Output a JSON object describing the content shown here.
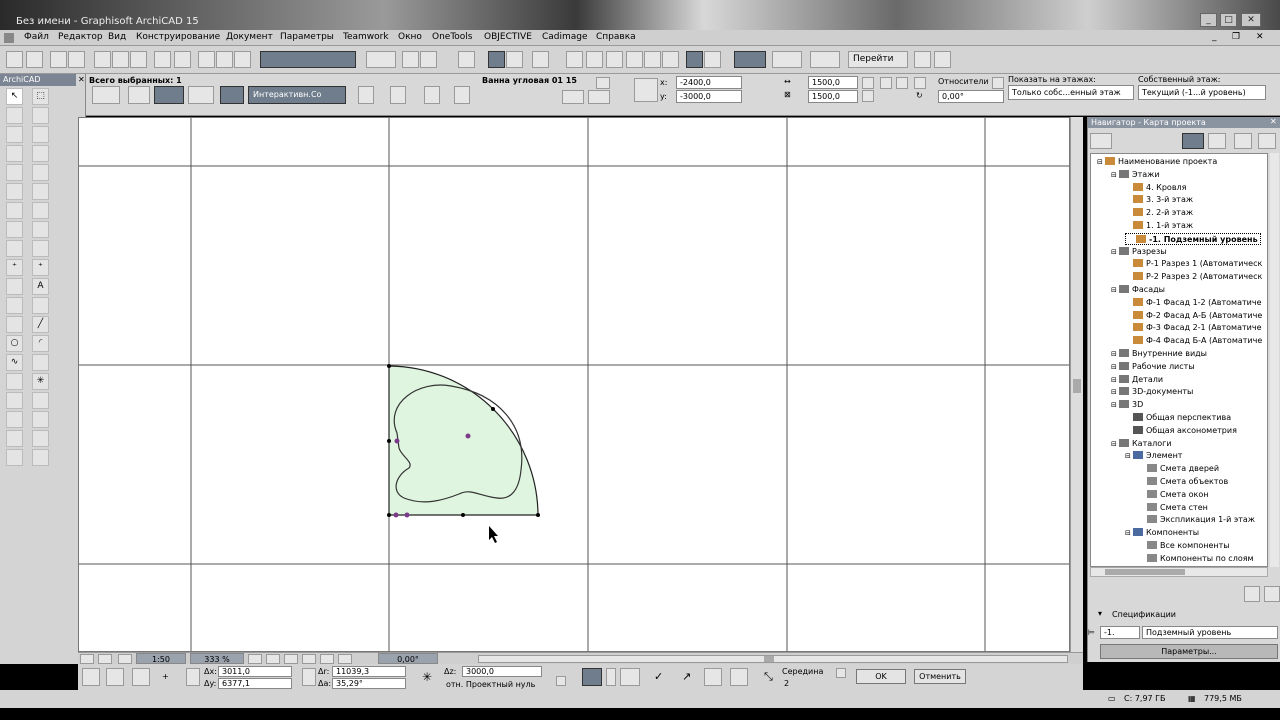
{
  "window": {
    "title": "Без имени - Graphisoft ArchiCAD 15"
  },
  "menu": [
    "Файл",
    "Редактор",
    "Вид",
    "Конструирование",
    "Документ",
    "Параметры",
    "Teamwork",
    "Окно",
    "OneTools",
    "OBJECTIVE",
    "Cadimage",
    "Справка"
  ],
  "toolbar": {
    "goto_label": "Перейти"
  },
  "toolbox": {
    "title": "ArchiCAD"
  },
  "infobox": {
    "selected_count": "Всего выбранных: 1",
    "interactive_label": "Интерактивн.Со",
    "object_name": "Ванна угловая 01 15",
    "x_label": "x:",
    "x_value": "-2400,0",
    "y_label": "y:",
    "y_value": "-3000,0",
    "w_value": "1500,0",
    "h_value": "1500,0",
    "relative_label": "Относители",
    "angle_value": "0,00°",
    "show_floors_label": "Показать на этажах:",
    "show_floors_value": "Только собс...енный этаж",
    "own_floor_label": "Собственный этаж:",
    "own_floor_value": "Текущий (-1...й уровень)"
  },
  "navigator": {
    "title": "Навигатор - Карта проекта",
    "tree": [
      {
        "label": "Наименование проекта",
        "level": 0,
        "icon": "project-icon"
      },
      {
        "label": "Этажи",
        "level": 1,
        "icon": "floors-icon"
      },
      {
        "label": "4. Кровля",
        "level": 2,
        "icon": "floor-icon"
      },
      {
        "label": "3. 3-й этаж",
        "level": 2,
        "icon": "floor-icon"
      },
      {
        "label": "2. 2-й этаж",
        "level": 2,
        "icon": "floor-icon"
      },
      {
        "label": "1. 1-й этаж",
        "level": 2,
        "icon": "floor-icon"
      },
      {
        "label": "-1. Подземный уровень",
        "level": 2,
        "icon": "floor-icon",
        "selected": true
      },
      {
        "label": "Разрезы",
        "level": 1,
        "icon": "sections-icon"
      },
      {
        "label": "Р-1 Разрез 1 (Автоматическ",
        "level": 2,
        "icon": "section-icon"
      },
      {
        "label": "Р-2 Разрез 2 (Автоматическ",
        "level": 2,
        "icon": "section-icon"
      },
      {
        "label": "Фасады",
        "level": 1,
        "icon": "elevations-icon"
      },
      {
        "label": "Ф-1 Фасад 1-2 (Автоматиче",
        "level": 2,
        "icon": "elevation-icon"
      },
      {
        "label": "Ф-2 Фасад А-Б (Автоматиче",
        "level": 2,
        "icon": "elevation-icon"
      },
      {
        "label": "Ф-3 Фасад 2-1 (Автоматиче",
        "level": 2,
        "icon": "elevation-icon"
      },
      {
        "label": "Ф-4 Фасад Б-А (Автоматиче",
        "level": 2,
        "icon": "elevation-icon"
      },
      {
        "label": "Внутренние виды",
        "level": 1,
        "icon": "interior-icon"
      },
      {
        "label": "Рабочие листы",
        "level": 1,
        "icon": "worksheet-icon"
      },
      {
        "label": "Детали",
        "level": 1,
        "icon": "detail-icon"
      },
      {
        "label": "3D-документы",
        "level": 1,
        "icon": "3d-doc-icon"
      },
      {
        "label": "3D",
        "level": 1,
        "icon": "3d-icon"
      },
      {
        "label": "Общая перспектива",
        "level": 2,
        "icon": "camera-icon"
      },
      {
        "label": "Общая аксонометрия",
        "level": 2,
        "icon": "axon-icon"
      },
      {
        "label": "Каталоги",
        "level": 1,
        "icon": "catalogs-icon"
      },
      {
        "label": "Элемент",
        "level": 2,
        "icon": "element-icon"
      },
      {
        "label": "Смета дверей",
        "level": 3,
        "icon": "schedule-icon"
      },
      {
        "label": "Смета объектов",
        "level": 3,
        "icon": "schedule-icon"
      },
      {
        "label": "Смета окон",
        "level": 3,
        "icon": "schedule-icon"
      },
      {
        "label": "Смета стен",
        "level": 3,
        "icon": "schedule-icon"
      },
      {
        "label": "Экспликация 1-й этаж",
        "level": 3,
        "icon": "schedule-icon"
      },
      {
        "label": "Компоненты",
        "level": 2,
        "icon": "components-icon"
      },
      {
        "label": "Все компоненты",
        "level": 3,
        "icon": "schedule-icon"
      },
      {
        "label": "Компоненты по слоям",
        "level": 3,
        "icon": "schedule-icon"
      }
    ],
    "spec_label": "Спецификации",
    "spec_id": "-1.",
    "spec_value": "Подземный уровень",
    "params_button": "Параметры..."
  },
  "canvas_bar": {
    "scale": "1:50",
    "zoom": "333 %",
    "angle": "0,00°"
  },
  "status": {
    "dx_label": "Δx:",
    "dx": "3011,0",
    "dy_label": "Δy:",
    "dy": "6377,1",
    "dr_label": "Δr:",
    "dr": "11039,3",
    "da_label": "Δa:",
    "da": "35,29°",
    "dz_label": "Δz:",
    "dz": "3000,0",
    "ref_label": "отн. Проектный нуль",
    "snap_label": "Середина",
    "snap_count": "2",
    "ok": "OK",
    "cancel": "Отменить"
  },
  "os": {
    "disk": "С: 7,97 ГБ",
    "mem": "779,5 МБ"
  },
  "colors": {
    "shape_fill": "#dff5df",
    "selection": "#7b3a8a"
  }
}
